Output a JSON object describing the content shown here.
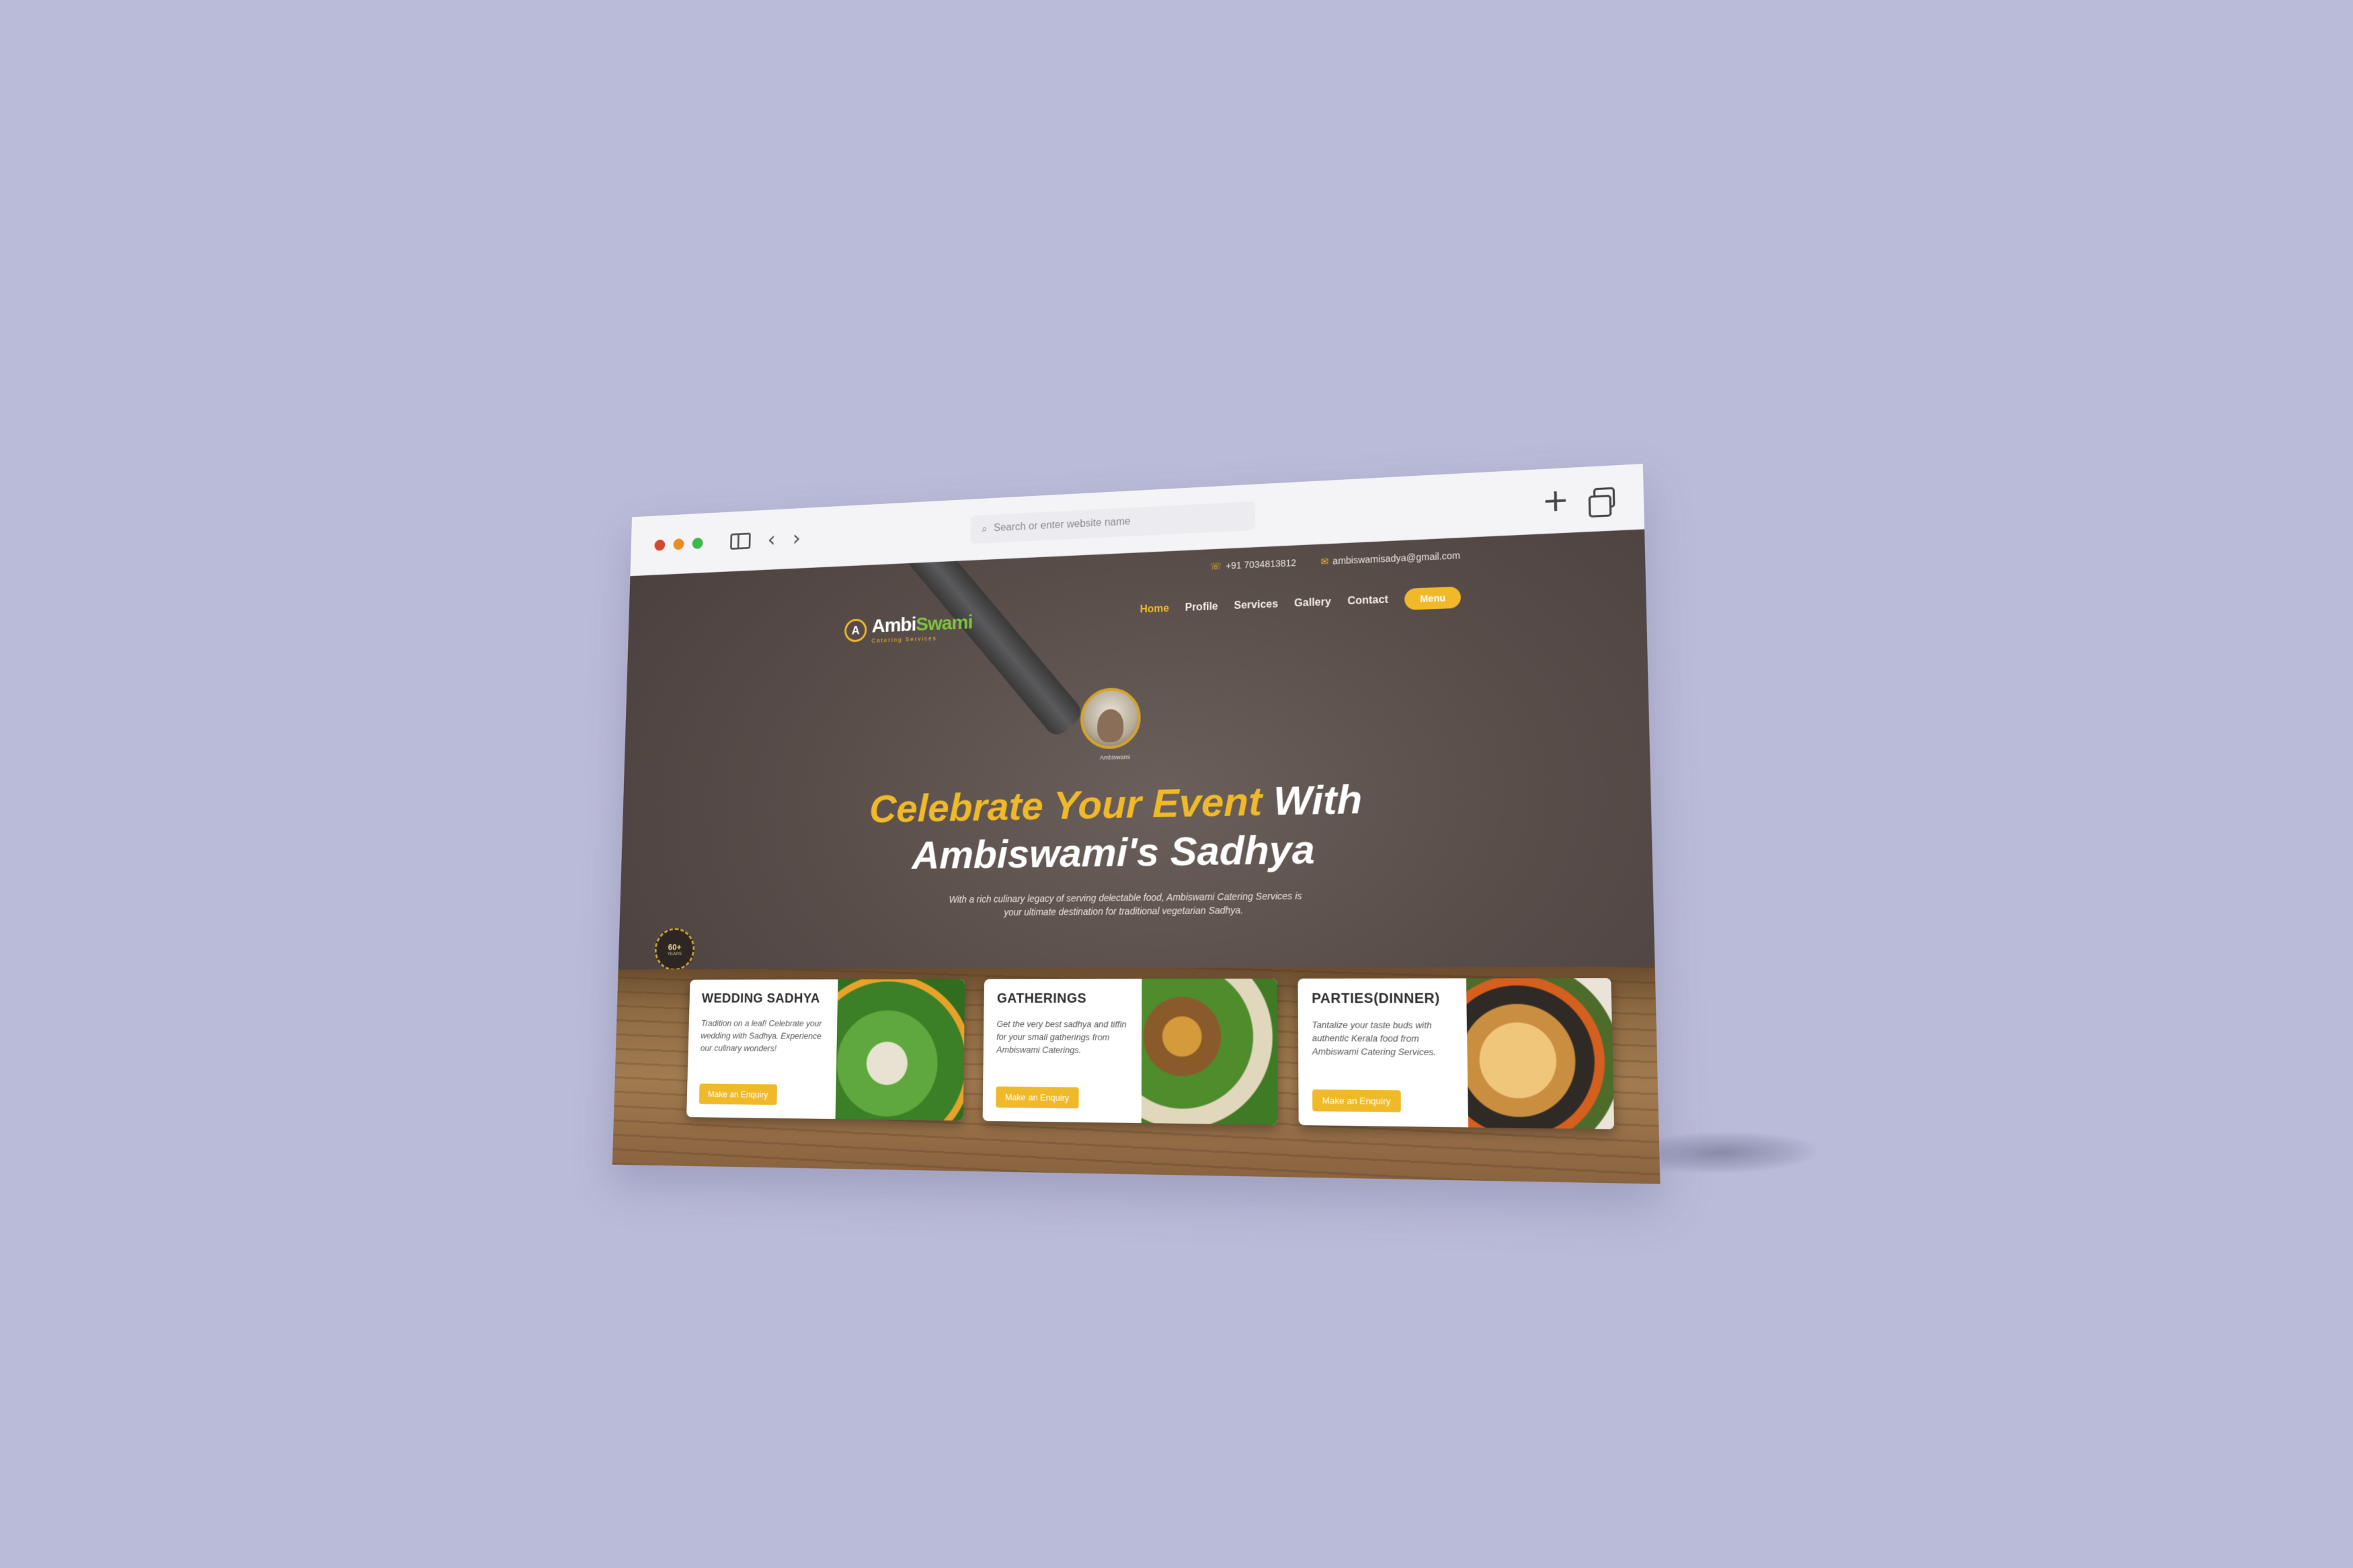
{
  "browser": {
    "address_placeholder": "Search or enter website name",
    "back_glyph": "‹",
    "forward_glyph": "›",
    "new_tab_glyph": "+",
    "search_glyph": "⌕"
  },
  "site": {
    "topbar": {
      "phone": "+91 7034813812",
      "email": "ambiswamisadya@gmail.com"
    },
    "logo": {
      "mark": "A",
      "name_part1": "Ambi",
      "name_part2": "Swami",
      "subtitle": "Catering Services"
    },
    "nav": {
      "items": [
        "Home",
        "Profile",
        "Services",
        "Gallery",
        "Contact"
      ],
      "active_index": 0,
      "menu_label": "Menu"
    },
    "portrait_label": "Ambiswami",
    "hero": {
      "title_gold": "Celebrate Your Event",
      "title_white_1": " With",
      "title_white_2": "Ambiswami's Sadhya",
      "description": "With a rich culinary legacy of serving delectable food, Ambiswami Catering Services is your ultimate destination for traditional vegetarian Sadhya."
    },
    "award": {
      "value": "60+",
      "caption": "YEARS"
    },
    "cards": [
      {
        "title": "WEDDING SADHYA",
        "text": "Tradition on a leaf! Celebrate your wedding with Sadhya. Experience our culinary wonders!",
        "button": "Make an Enquiry"
      },
      {
        "title": "GATHERINGS",
        "text": "Get the very best sadhya and tiffin for your small gatherings from Ambiswami Caterings.",
        "button": "Make an Enquiry"
      },
      {
        "title": "PARTIES(DINNER)",
        "text": "Tantalize your taste buds with authentic Kerala food from Ambiswami Catering Services.",
        "button": "Make an Enquiry"
      }
    ]
  },
  "colors": {
    "background": "#babbd8",
    "accent_gold": "#f0b92a",
    "logo_green": "#7fc242"
  },
  "icons": {
    "phone": "phone-icon",
    "email": "email-icon",
    "sidebar": "sidebar-toggle-icon",
    "tabs": "tabs-overview-icon"
  }
}
